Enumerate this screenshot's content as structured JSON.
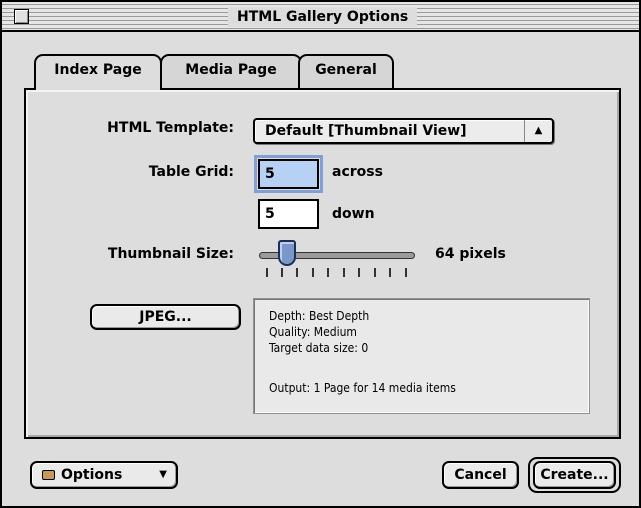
{
  "window": {
    "title": "HTML Gallery Options"
  },
  "tabs": [
    {
      "label": "Index Page"
    },
    {
      "label": "Media Page"
    },
    {
      "label": "General"
    }
  ],
  "index_page": {
    "html_template": {
      "label": "HTML Template:",
      "value": "Default [Thumbnail View]"
    },
    "table_grid": {
      "label": "Table Grid:",
      "across_value": "5",
      "across_label": "across",
      "down_value": "5",
      "down_label": "down"
    },
    "thumbnail_size": {
      "label": "Thumbnail Size:",
      "value_text": "64 pixels",
      "slider_fraction": 0.15
    },
    "jpeg_button": "JPEG...",
    "info": {
      "depth": "Depth: Best Depth",
      "quality": "Quality: Medium",
      "target": "Target data size: 0",
      "output": "Output: 1 Page for 14 media items"
    }
  },
  "footer": {
    "options_label": "Options",
    "cancel_label": "Cancel",
    "create_label": "Create..."
  }
}
